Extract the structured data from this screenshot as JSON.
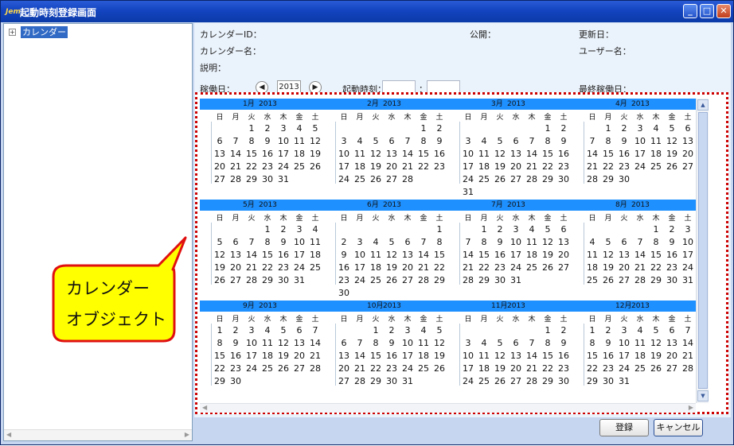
{
  "window": {
    "title": "起動時刻登録画面",
    "logo": "Jem"
  },
  "tree": {
    "expander": "+",
    "root_label": "カレンダー"
  },
  "form": {
    "calendar_id_label": "カレンダーID：",
    "public_label": "公開：",
    "updated_label": "更新日：",
    "calendar_name_label": "カレンダー名：",
    "user_name_label": "ユーザー名：",
    "description_label": "説明：",
    "operating_day_label": "稼働日：",
    "year_value": "2013",
    "start_time_label": "起動時刻：",
    "time_separator": "：",
    "last_operating_label": "最終稼働日："
  },
  "calendar": {
    "year": "2013",
    "weekdays": [
      "日",
      "月",
      "火",
      "水",
      "木",
      "金",
      "土"
    ],
    "months": [
      {
        "label": "1月",
        "first_weekday": 2,
        "days": 31
      },
      {
        "label": "2月",
        "first_weekday": 5,
        "days": 28
      },
      {
        "label": "3月",
        "first_weekday": 5,
        "days": 31
      },
      {
        "label": "4月",
        "first_weekday": 1,
        "days": 30
      },
      {
        "label": "5月",
        "first_weekday": 3,
        "days": 31
      },
      {
        "label": "6月",
        "first_weekday": 6,
        "days": 30
      },
      {
        "label": "7月",
        "first_weekday": 1,
        "days": 31
      },
      {
        "label": "8月",
        "first_weekday": 4,
        "days": 31
      },
      {
        "label": "9月",
        "first_weekday": 0,
        "days": 30
      },
      {
        "label": "10月",
        "first_weekday": 2,
        "days": 31
      },
      {
        "label": "11月",
        "first_weekday": 5,
        "days": 30
      },
      {
        "label": "12月",
        "first_weekday": 0,
        "days": 31
      }
    ]
  },
  "buttons": {
    "register": "登録",
    "cancel": "キャンセル"
  },
  "callout": {
    "line1": "カレンダー",
    "line2": "オブジェクト"
  },
  "colors": {
    "month_header": "#1e90ff",
    "highlight_border": "#cc0000",
    "callout_fill": "#ffff00",
    "callout_border": "#e01010"
  }
}
